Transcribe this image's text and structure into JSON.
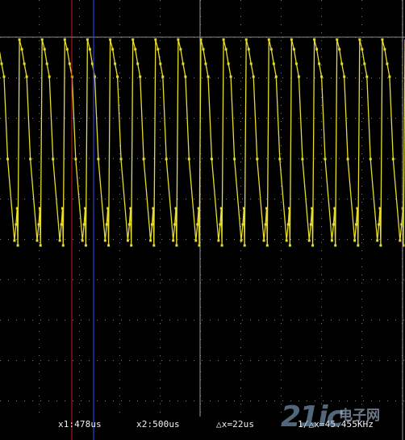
{
  "chart_data": {
    "type": "line",
    "description_values": {
      "signal_min": 0,
      "signal_max": 1
    },
    "grid": true,
    "series": [
      {
        "color": "#e6dc2c",
        "marker": "dot",
        "sawtooth_cycles": 18
      }
    ],
    "cursors": {
      "x1": {
        "label": "x1:478us",
        "color": "#c81e1e",
        "time_us": 478
      },
      "x2": {
        "label": "x2:500us",
        "color": "#2b44c8",
        "time_us": 500
      }
    },
    "readouts": {
      "x1": "x1:478us",
      "x2": "x2:500us",
      "dx": "△x=22us",
      "freq": "1/△x=45.455KHz"
    }
  },
  "colors": {
    "background": "#000000",
    "grid": "#7a7a7a",
    "trace": "#e6dc2c",
    "center_line": "#9a9a9a"
  },
  "watermark": {
    "logo": "21ic",
    "name": "电子网"
  }
}
